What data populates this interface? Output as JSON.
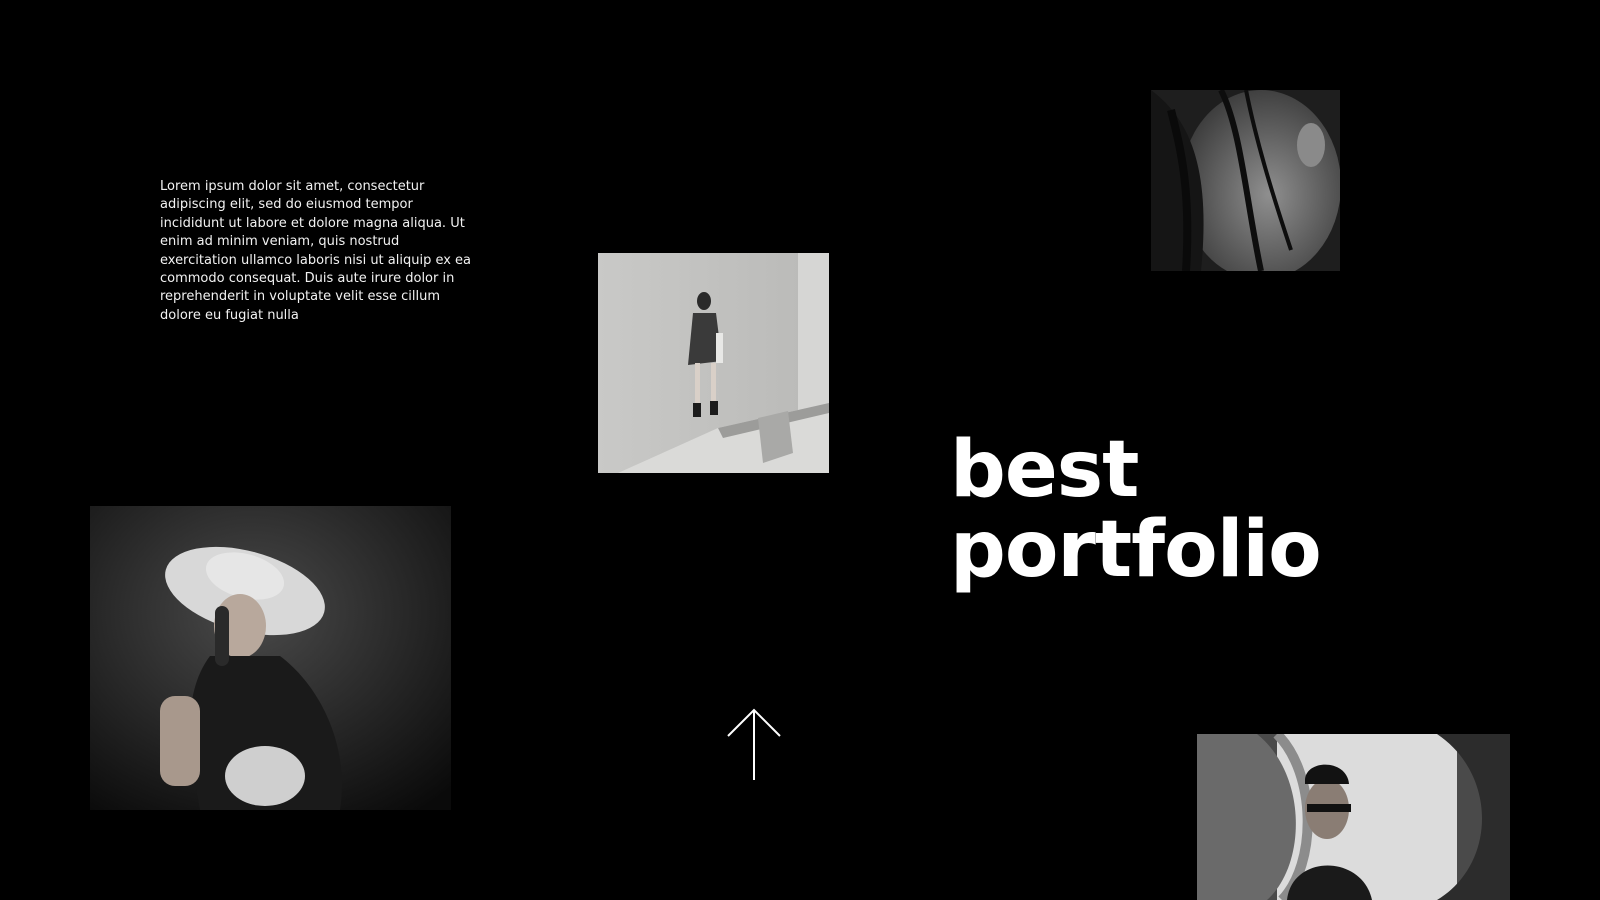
{
  "intro": {
    "body": "Lorem ipsum dolor sit amet, consectetur adipiscing elit, sed do eiusmod tempor incididunt ut labore et dolore magna aliqua. Ut enim ad minim veniam, quis nostrud exercitation ullamco laboris nisi ut aliquip ex ea commodo consequat. Duis aute irure dolor in reprehenderit in voluptate velit esse cillum dolore eu fugiat nulla"
  },
  "headline": {
    "line1": "best",
    "line2": "portfolio"
  },
  "navigation": {
    "scroll_icon": "arrow-up-icon"
  },
  "colors": {
    "background": "#000000",
    "text": "#ffffff"
  }
}
